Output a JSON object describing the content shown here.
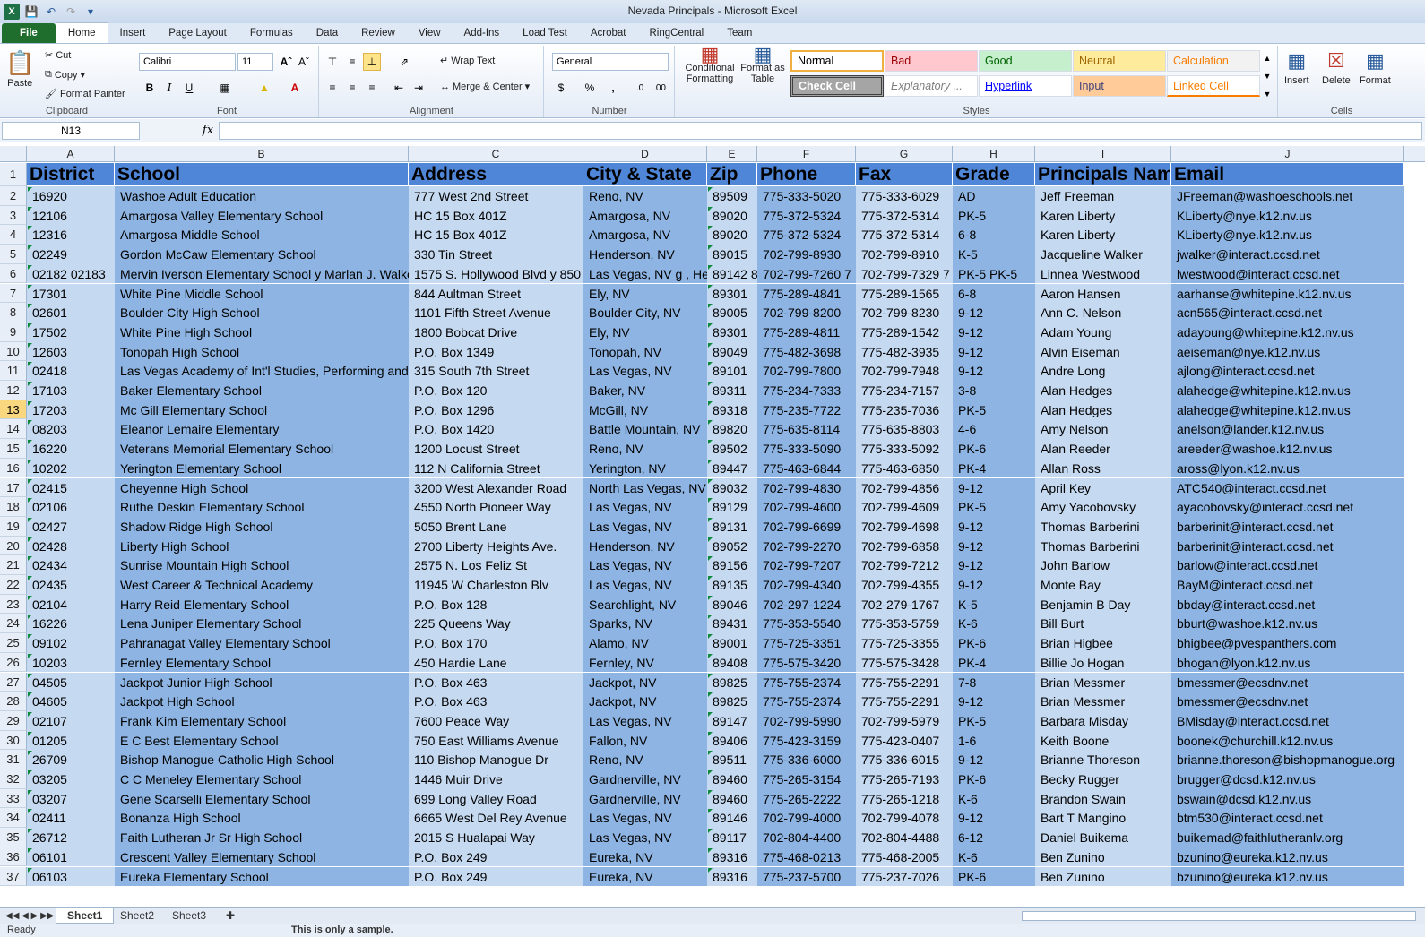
{
  "window": {
    "title": "Nevada Principals  -  Microsoft Excel"
  },
  "tabs": [
    "File",
    "Home",
    "Insert",
    "Page Layout",
    "Formulas",
    "Data",
    "Review",
    "View",
    "Add-Ins",
    "Load Test",
    "Acrobat",
    "RingCentral",
    "Team"
  ],
  "ribbon": {
    "clipboard": {
      "label": "Clipboard",
      "paste": "Paste",
      "cut": "Cut",
      "copy": "Copy",
      "format_painter": "Format Painter"
    },
    "font": {
      "label": "Font",
      "name": "Calibri",
      "size": "11"
    },
    "alignment": {
      "label": "Alignment",
      "wrap": "Wrap Text",
      "merge": "Merge & Center"
    },
    "number": {
      "label": "Number",
      "format": "General"
    },
    "styles": {
      "label": "Styles",
      "conditional": "Conditional Formatting",
      "format_table": "Format as Table",
      "cells": [
        {
          "name": "Normal",
          "bg": "#ffffff",
          "fg": "#000000"
        },
        {
          "name": "Bad",
          "bg": "#ffc7ce",
          "fg": "#9c0006"
        },
        {
          "name": "Good",
          "bg": "#c6efce",
          "fg": "#006100"
        },
        {
          "name": "Neutral",
          "bg": "#ffeb9c",
          "fg": "#9c6500"
        },
        {
          "name": "Calculation",
          "bg": "#f2f2f2",
          "fg": "#fa7d00"
        },
        {
          "name": "Check Cell",
          "bg": "#a5a5a5",
          "fg": "#ffffff"
        },
        {
          "name": "Explanatory ...",
          "bg": "#ffffff",
          "fg": "#7f7f7f"
        },
        {
          "name": "Hyperlink",
          "bg": "#ffffff",
          "fg": "#0000ff"
        },
        {
          "name": "Input",
          "bg": "#ffcc99",
          "fg": "#3f3f76"
        },
        {
          "name": "Linked Cell",
          "bg": "#ffffff",
          "fg": "#fa7d00"
        }
      ]
    },
    "cells": {
      "label": "Cells",
      "insert": "Insert",
      "delete": "Delete",
      "format": "Format"
    }
  },
  "formula_bar": {
    "name_box": "N13",
    "fx": "fx",
    "value": ""
  },
  "columns": [
    "A",
    "B",
    "C",
    "D",
    "E",
    "F",
    "G",
    "H",
    "I",
    "J"
  ],
  "header_row": [
    "District",
    "School",
    "Address",
    "City & State",
    "Zip",
    "Phone",
    "Fax",
    "Grade",
    "Principals Nam",
    "Email"
  ],
  "rows": [
    [
      "16920",
      "Washoe Adult Education",
      "777 West 2nd Street",
      "Reno, NV",
      "89509",
      "775-333-5020",
      "775-333-6029",
      "AD",
      "Jeff Freeman",
      " JFreeman@washoeschools.net"
    ],
    [
      "12106",
      "Amargosa Valley Elementary School",
      "HC 15 Box 401Z",
      "Amargosa, NV",
      "89020",
      "775-372-5324",
      "775-372-5314",
      "PK-5",
      "Karen Liberty",
      " KLiberty@nye.k12.nv.us"
    ],
    [
      "12316",
      "Amargosa Middle School",
      "HC 15 Box 401Z",
      "Amargosa, NV",
      "89020",
      "775-372-5324",
      "775-372-5314",
      "6-8",
      "Karen Liberty",
      " KLiberty@nye.k12.nv.us"
    ],
    [
      "02249",
      "Gordon McCaw Elementary School",
      "330 Tin Street",
      "Henderson, NV",
      "89015",
      "702-799-8930",
      "702-799-8910",
      "K-5",
      "Jacqueline Walker",
      " jwalker@interact.ccsd.net"
    ],
    [
      "02182 02183",
      "Mervin Iverson Elementary School y Marlan J. Walker",
      "1575 S. Hollywood Blvd y 850",
      "Las Vegas, NV g , He",
      "89142 8",
      "702-799-7260 7",
      "702-799-7329 7",
      "PK-5 PK-5",
      "Linnea Westwood",
      " lwestwood@interact.ccsd.net"
    ],
    [
      "17301",
      "White Pine Middle School",
      "844 Aultman Street",
      "Ely, NV",
      "89301",
      "775-289-4841",
      "775-289-1565",
      "6-8",
      "Aaron Hansen",
      "aarhanse@whitepine.k12.nv.us"
    ],
    [
      "02601",
      "Boulder City High School",
      "1101 Fifth Street Avenue",
      "Boulder City, NV",
      "89005",
      "702-799-8200",
      "702-799-8230",
      "9-12",
      "Ann C. Nelson",
      "acn565@interact.ccsd.net"
    ],
    [
      "17502",
      "White Pine High School",
      "1800 Bobcat Drive",
      "Ely, NV",
      "89301",
      "775-289-4811",
      "775-289-1542",
      "9-12",
      "Adam Young",
      "adayoung@whitepine.k12.nv.us"
    ],
    [
      "12603",
      "Tonopah High School",
      "P.O. Box 1349",
      "Tonopah, NV",
      "89049",
      "775-482-3698",
      "775-482-3935",
      "9-12",
      "Alvin Eiseman",
      "aeiseman@nye.k12.nv.us"
    ],
    [
      "02418",
      "Las Vegas Academy of Int'l Studies, Performing and",
      "315 South 7th Street",
      "Las Vegas, NV",
      "89101",
      "702-799-7800",
      "702-799-7948",
      "9-12",
      "Andre Long",
      "ajlong@interact.ccsd.net"
    ],
    [
      "17103",
      "Baker Elementary School",
      "P.O. Box 120",
      "Baker, NV",
      "89311",
      "775-234-7333",
      "775-234-7157",
      "3-8",
      "Alan Hedges",
      "alahedge@whitepine.k12.nv.us"
    ],
    [
      "17203",
      "Mc Gill Elementary School",
      "P.O. Box 1296",
      "McGill, NV",
      "89318",
      "775-235-7722",
      "775-235-7036",
      "PK-5",
      "Alan Hedges",
      "alahedge@whitepine.k12.nv.us"
    ],
    [
      "08203",
      "Eleanor Lemaire Elementary",
      "P.O. Box 1420",
      "Battle Mountain, NV",
      "89820",
      "775-635-8114",
      "775-635-8803",
      "4-6",
      "Amy Nelson",
      "anelson@lander.k12.nv.us"
    ],
    [
      "16220",
      "Veterans Memorial Elementary School",
      "1200 Locust Street",
      "Reno, NV",
      "89502",
      "775-333-5090",
      "775-333-5092",
      "PK-6",
      "Alan Reeder",
      "areeder@washoe.k12.nv.us"
    ],
    [
      "10202",
      "Yerington Elementary School",
      "112 N California Street",
      "Yerington, NV",
      "89447",
      "775-463-6844",
      "775-463-6850",
      "PK-4",
      "Allan Ross",
      "aross@lyon.k12.nv.us"
    ],
    [
      "02415",
      "Cheyenne High School",
      "3200 West Alexander Road",
      "North Las Vegas, NV",
      "89032",
      "702-799-4830",
      "702-799-4856",
      "9-12",
      "April Key",
      "ATC540@interact.ccsd.net"
    ],
    [
      "02106",
      "Ruthe Deskin Elementary School",
      "4550 North Pioneer Way",
      "Las Vegas, NV",
      "89129",
      "702-799-4600",
      "702-799-4609",
      "PK-5",
      "Amy Yacobovsky",
      "ayacobovsky@interact.ccsd.net"
    ],
    [
      "02427",
      "Shadow Ridge High School",
      "5050 Brent Lane",
      "Las Vegas, NV",
      "89131",
      "702-799-6699",
      "702-799-4698",
      "9-12",
      "Thomas Barberini",
      "barberinit@interact.ccsd.net"
    ],
    [
      "02428",
      "Liberty High School",
      "2700 Liberty Heights Ave.",
      "Henderson, NV",
      "89052",
      "702-799-2270",
      "702-799-6858",
      "9-12",
      "Thomas Barberini",
      "barberinit@interact.ccsd.net"
    ],
    [
      "02434",
      "Sunrise Mountain High School",
      "2575 N. Los Feliz St",
      "Las Vegas, NV",
      "89156",
      "702-799-7207",
      "702-799-7212",
      "9-12",
      "John Barlow",
      "barlow@interact.ccsd.net"
    ],
    [
      "02435",
      "West Career & Technical Academy",
      "11945 W Charleston Blv",
      "Las Vegas, NV",
      "89135",
      "702-799-4340",
      "702-799-4355",
      "9-12",
      "Monte Bay",
      "BayM@interact.ccsd.net"
    ],
    [
      "02104",
      "Harry Reid Elementary School",
      "P.O. Box 128",
      "Searchlight, NV",
      "89046",
      "702-297-1224",
      "702-279-1767",
      "K-5",
      "Benjamin B Day",
      "bbday@interact.ccsd.net"
    ],
    [
      "16226",
      "Lena Juniper Elementary School",
      "225 Queens Way",
      "Sparks, NV",
      "89431",
      "775-353-5540",
      "775-353-5759",
      "K-6",
      "Bill Burt",
      "bburt@washoe.k12.nv.us"
    ],
    [
      "09102",
      "Pahranagat Valley Elementary School",
      "P.O. Box 170",
      "Alamo, NV",
      "89001",
      "775-725-3351",
      "775-725-3355",
      "PK-6",
      "Brian Higbee",
      "bhigbee@pvespanthers.com"
    ],
    [
      "10203",
      "Fernley Elementary School",
      "450 Hardie Lane",
      "Fernley, NV",
      "89408",
      "775-575-3420",
      "775-575-3428",
      "PK-4",
      "Billie Jo Hogan",
      "bhogan@lyon.k12.nv.us"
    ],
    [
      "04505",
      "Jackpot Junior High School",
      "P.O. Box 463",
      "Jackpot, NV",
      "89825",
      "775-755-2374",
      "775-755-2291",
      "7-8",
      "Brian Messmer",
      "bmessmer@ecsdnv.net"
    ],
    [
      "04605",
      "Jackpot High School",
      "P.O. Box 463",
      "Jackpot, NV",
      "89825",
      "775-755-2374",
      "775-755-2291",
      "9-12",
      "Brian Messmer",
      "bmessmer@ecsdnv.net"
    ],
    [
      "02107",
      "Frank Kim Elementary School",
      "7600 Peace Way",
      "Las Vegas, NV",
      "89147",
      "702-799-5990",
      "702-799-5979",
      "PK-5",
      "Barbara Misday",
      "BMisday@interact.ccsd.net"
    ],
    [
      "01205",
      "E C Best Elementary School",
      "750 East Williams Avenue",
      "Fallon, NV",
      "89406",
      "775-423-3159",
      "775-423-0407",
      "1-6",
      "Keith Boone",
      "boonek@churchill.k12.nv.us"
    ],
    [
      "26709",
      "Bishop Manogue Catholic High School",
      "110 Bishop Manogue Dr",
      "Reno, NV",
      "89511",
      "775-336-6000",
      "775-336-6015",
      "9-12",
      "Brianne Thoreson",
      "brianne.thoreson@bishopmanogue.org"
    ],
    [
      "03205",
      "C C Meneley Elementary School",
      "1446 Muir Drive",
      "Gardnerville, NV",
      "89460",
      "775-265-3154",
      "775-265-7193",
      "PK-6",
      "Becky Rugger",
      "brugger@dcsd.k12.nv.us"
    ],
    [
      "03207",
      "Gene Scarselli Elementary School",
      "699 Long Valley Road",
      "Gardnerville, NV",
      "89460",
      "775-265-2222",
      "775-265-1218",
      "K-6",
      "Brandon Swain",
      "bswain@dcsd.k12.nv.us"
    ],
    [
      "02411",
      "Bonanza High School",
      "6665 West Del Rey Avenue",
      "Las Vegas, NV",
      "89146",
      "702-799-4000",
      "702-799-4078",
      "9-12",
      "Bart T Mangino",
      "btm530@interact.ccsd.net"
    ],
    [
      "26712",
      "Faith Lutheran Jr Sr High School",
      "2015 S Hualapai Way",
      "Las Vegas, NV",
      "89117",
      "702-804-4400",
      "702-804-4488",
      "6-12",
      "Daniel Buikema",
      "buikemad@faithlutheranlv.org"
    ],
    [
      "06101",
      "Crescent Valley Elementary School",
      "P.O. Box 249",
      "Eureka, NV",
      "89316",
      "775-468-0213",
      "775-468-2005",
      "K-6",
      "Ben Zunino",
      "bzunino@eureka.k12.nv.us"
    ],
    [
      "06103",
      "Eureka Elementary School",
      "P.O. Box 249",
      "Eureka, NV",
      "89316",
      "775-237-5700",
      "775-237-7026",
      "PK-6",
      "Ben Zunino",
      "bzunino@eureka.k12.nv.us"
    ]
  ],
  "sheets": [
    "Sheet1",
    "Sheet2",
    "Sheet3"
  ],
  "status": {
    "ready": "Ready",
    "note": "This is only a sample."
  }
}
